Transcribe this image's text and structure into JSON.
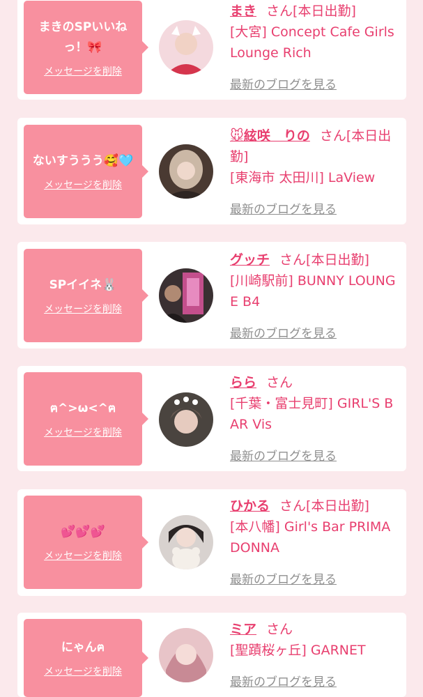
{
  "common": {
    "delete_label": "メッセージを削除",
    "blog_label": "最新のブログを見る",
    "san": "さん"
  },
  "items": [
    {
      "message": "まきのSPいいねっ！🎀",
      "name": "まき",
      "status": "[本日出勤]",
      "shop": "[大宮] Concept Cafe Girls Lounge Rich",
      "avatar_colors": [
        "#f4d9de",
        "#d5354d"
      ]
    },
    {
      "message": "ないすううう🥰🩵",
      "name": "🐭絃咲　りの",
      "status": "[本日出勤]",
      "shop": "[東海市 太田川] LaView",
      "avatar_colors": [
        "#cbb8a6",
        "#4a3a32"
      ]
    },
    {
      "message": "SPイイネ🐰",
      "name": "グッチ",
      "status": "[本日出勤]",
      "shop": "[川崎駅前] BUNNY LOUNGE B4",
      "avatar_colors": [
        "#3a3032",
        "#c34f8c"
      ]
    },
    {
      "message": "ฅ^>ω<^ฅ",
      "name": "らら",
      "status": "",
      "shop": "[千葉・富士見町] GIRL'S BAR Vis",
      "avatar_colors": [
        "#4a443f",
        "#c9a59a"
      ]
    },
    {
      "message": "💕💕💕",
      "name": "ひかる",
      "status": "[本日出勤]",
      "shop": "[本八幡] Girl's Bar PRIMADONNA",
      "avatar_colors": [
        "#d8d2cf",
        "#2a2424"
      ]
    },
    {
      "message": "にゃんฅ",
      "name": "ミア",
      "status": "",
      "shop": "[聖蹟桜ヶ丘] GARNET",
      "avatar_colors": [
        "#e8c4c8",
        "#c88a95"
      ]
    }
  ]
}
